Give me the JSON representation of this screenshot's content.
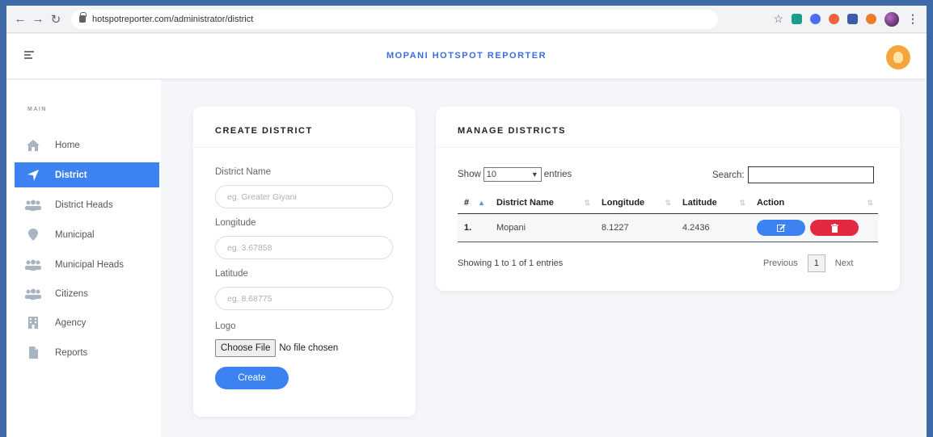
{
  "browser": {
    "url": "hotspotreporter.com/administrator/district"
  },
  "header": {
    "title": "MOPANI HOTSPOT REPORTER"
  },
  "sidebar": {
    "section": "MAIN",
    "items": [
      {
        "label": "Home",
        "icon": "home-icon"
      },
      {
        "label": "District",
        "icon": "location-arrow-icon",
        "active": true
      },
      {
        "label": "District Heads",
        "icon": "users-icon"
      },
      {
        "label": "Municipal",
        "icon": "map-pin-icon"
      },
      {
        "label": "Municipal Heads",
        "icon": "users-icon"
      },
      {
        "label": "Citizens",
        "icon": "users-icon"
      },
      {
        "label": "Agency",
        "icon": "building-icon"
      },
      {
        "label": "Reports",
        "icon": "file-icon"
      }
    ]
  },
  "create": {
    "title": "CREATE DISTRICT",
    "district_name_label": "District Name",
    "district_name_placeholder": "eg. Greater Giyani",
    "longitude_label": "Longitude",
    "longitude_placeholder": "eg. 3.67858",
    "latitude_label": "Latitude",
    "latitude_placeholder": "eg. 8.68775",
    "logo_label": "Logo",
    "choose_file": "Choose File",
    "no_file": "No file chosen",
    "submit": "Create"
  },
  "manage": {
    "title": "MANAGE DISTRICTS",
    "show_label": "Show",
    "entries_value": "10",
    "entries_label": "entries",
    "search_label": "Search:",
    "columns": [
      "#",
      "District Name",
      "Longitude",
      "Latitude",
      "Action"
    ],
    "rows": [
      {
        "num": "1.",
        "name": "Mopani",
        "longitude": "8.1227",
        "latitude": "4.2436"
      }
    ],
    "info": "Showing 1 to 1 of 1 entries",
    "previous": "Previous",
    "page": "1",
    "next": "Next"
  },
  "colors": {
    "accent": "#3c82f0",
    "danger": "#e2293f",
    "avatar": "#f7a53b"
  }
}
